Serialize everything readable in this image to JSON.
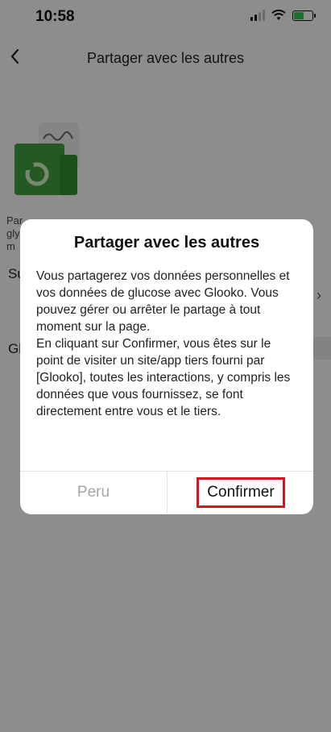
{
  "status_bar": {
    "time": "10:58",
    "icons": [
      "signal-icon",
      "wifi-icon",
      "battery-charging-icon"
    ],
    "battery_color": "#36c24a"
  },
  "nav": {
    "back_icon": "chevron-left-icon",
    "title": "Partager avec les autres"
  },
  "background_content": {
    "illustration_icon": "share-document-icon",
    "text_fragment_1": "Par",
    "text_fragment_2": "gly",
    "text_fragment_3": "m",
    "row1_fragment": "Su",
    "row2_fragment": "Gl"
  },
  "dialog": {
    "title": "Partager avec les autres",
    "body": "Vous partagerez vos données personnelles et vos données de glucose avec Glooko. Vous pouvez gérer ou arrêter le partage à tout moment sur la page.\nEn cliquant sur Confirmer, vous êtes sur le point de visiter un site/app tiers fourni par [Glooko], toutes les interactions, y compris les données que vous fournissez, se font directement entre vous et le tiers.",
    "cancel_label": "Peru",
    "confirm_label": "Confirmer"
  },
  "colors": {
    "highlight_border": "#d8121f",
    "cancel_text": "#a5a5a5",
    "illustration_green": "#3f9a3a"
  }
}
